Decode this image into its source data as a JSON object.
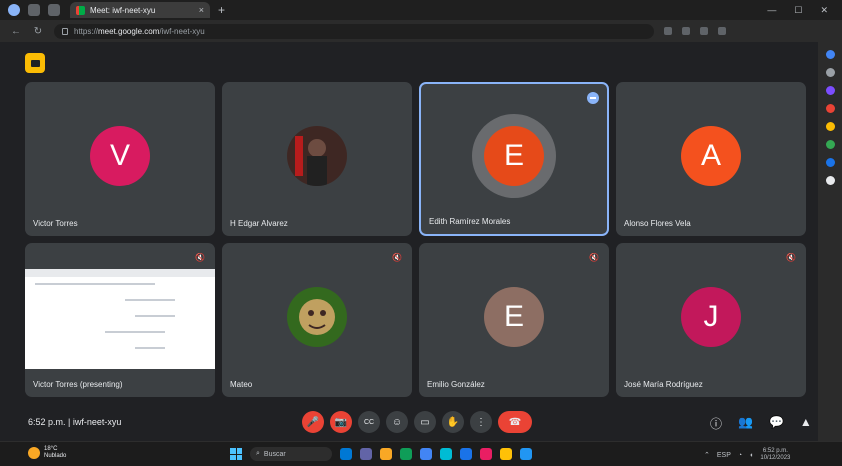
{
  "browser": {
    "tab_title": "Meet: iwf-neet-xyu",
    "url_prefix": "https://",
    "url_domain": "meet.google.com",
    "url_path": "/iwf-neet-xyu",
    "new_tab": "+",
    "close_tab": "×",
    "window_controls": [
      "—",
      "☐",
      "✕"
    ]
  },
  "meeting": {
    "time": "6:52 p.m.",
    "separator": "|",
    "code": "iwf-neet-xyu",
    "tiles": [
      {
        "name": "Victor Torres",
        "initial": "V",
        "color": "#d81b60",
        "type": "avatar"
      },
      {
        "name": "H Edgar Alvarez",
        "initial": "",
        "color": "#4e342e",
        "type": "photo"
      },
      {
        "name": "Edith Ramírez Morales",
        "initial": "E",
        "color": "#e64a19",
        "type": "avatar",
        "active": true
      },
      {
        "name": "Alonso Flores Vela",
        "initial": "A",
        "color": "#f4511e",
        "type": "avatar"
      },
      {
        "name": "Victor Torres (presenting)",
        "initial": "",
        "color": "#ffffff",
        "type": "presentation"
      },
      {
        "name": "Mateo",
        "initial": "",
        "color": "#827717",
        "type": "photo"
      },
      {
        "name": "Emilio González",
        "initial": "E",
        "color": "#8d6e63",
        "type": "avatar"
      },
      {
        "name": "José María Rodríguez",
        "initial": "J",
        "color": "#c2185b",
        "type": "avatar"
      }
    ]
  },
  "controls": {
    "mic": "🎤",
    "camera": "📷",
    "captions": "CC",
    "emoji": "☺",
    "present": "▭",
    "raise_hand": "✋",
    "more": "⋮",
    "end_call": "☎",
    "info": "ⓘ",
    "people": "👥",
    "chat": "💬",
    "activities": "▲"
  },
  "taskbar": {
    "weather_temp": "18°C",
    "weather_desc": "Nublado",
    "search_label": "Buscar",
    "lang": "ESP",
    "time": "6:52 p.m.",
    "date": "10/12/2023"
  },
  "colors": {
    "background": "#202124",
    "tile": "#3c4043",
    "active_border": "#8ab4f8",
    "end_call": "#ea4335"
  }
}
